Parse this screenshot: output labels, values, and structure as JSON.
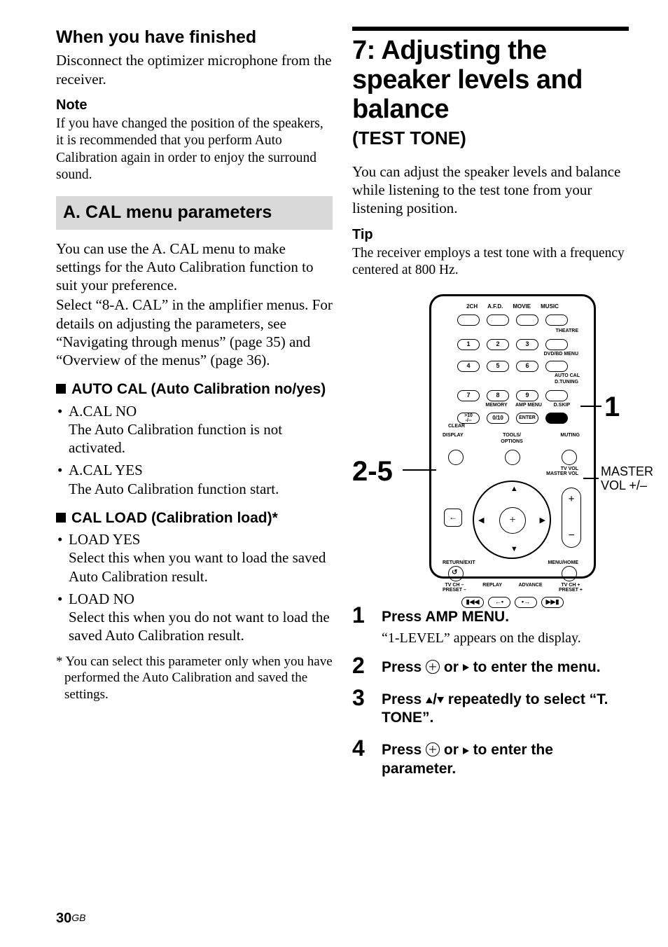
{
  "left": {
    "finished_heading": "When you have finished",
    "finished_text": "Disconnect the optimizer microphone from the receiver.",
    "note_heading": "Note",
    "note_text": "If you have changed the position of the speakers, it is recommended that you perform Auto Calibration again in order to enjoy the surround sound.",
    "band_heading": "A. CAL menu parameters",
    "band_intro1": "You can use the A. CAL menu to make settings for the Auto Calibration function to suit your preference.",
    "band_intro2": "Select “8-A. CAL” in the amplifier menus. For details on adjusting the parameters, see “Navigating through menus” (page 35) and “Overview of the menus” (page 36).",
    "block1_heading": "AUTO CAL (Auto Calibration no/yes)",
    "block1_items": [
      {
        "label": "A.CAL NO",
        "desc": "The Auto Calibration function is not activated."
      },
      {
        "label": "A.CAL YES",
        "desc": "The Auto Calibration function start."
      }
    ],
    "block2_heading": "CAL LOAD (Calibration load)*",
    "block2_items": [
      {
        "label": "LOAD YES",
        "desc": "Select this when you want to load the saved Auto Calibration result."
      },
      {
        "label": "LOAD NO",
        "desc": "Select this when you do not want to load the saved Auto Calibration result."
      }
    ],
    "footnote": "* You can select this parameter only when you have performed the Auto Calibration and saved the settings."
  },
  "right": {
    "title": "7: Adjusting the speaker levels and balance",
    "subtitle": "(TEST TONE)",
    "intro": "You can adjust the speaker levels and balance while listening to the test tone from your listening position.",
    "tip_heading": "Tip",
    "tip_text": "The receiver employs a test tone with a frequency centered at 800 Hz.",
    "remote": {
      "row0": [
        "2CH",
        "A.F.D.",
        "MOVIE",
        "MUSIC"
      ],
      "row_theatre": "THEATRE",
      "row1": [
        "1",
        "2",
        "3"
      ],
      "row_dvd": "DVD/BD MENU",
      "row2": [
        "4",
        "5",
        "6"
      ],
      "row_autocal": "AUTO CAL",
      "row_dtuning": "D.TUNING",
      "row3": [
        "7",
        "8",
        "9"
      ],
      "row_dskip": "D.SKIP",
      "row_mem": "MEMORY",
      "row_amp": "AMP MENU",
      "row4a": ">10",
      "row4b": "-/--",
      "row4_clear": "CLEAR",
      "row4c": "0/10",
      "row4d": "ENTER",
      "row_display": "DISPLAY",
      "row_tools": "TOOLS/\nOPTIONS",
      "row_muting": "MUTING",
      "row_tvvol": "TV VOL",
      "row_master": "MASTER VOL",
      "row_return": "RETURN/EXIT",
      "row_menuhome": "MENU/HOME",
      "row_tvchm": "TV CH –",
      "row_presetm": "PRESET –",
      "row_replay": "REPLAY",
      "row_advance": "ADVANCE",
      "row_tvchp": "TV CH +",
      "row_presetp": "PRESET +",
      "callout_25": "2-5",
      "callout_1": "1",
      "callout_master": "MASTER VOL +/–"
    },
    "steps": [
      {
        "num": "1",
        "title": "Press AMP MENU.",
        "desc": "“1-LEVEL” appears on the display."
      },
      {
        "num": "2",
        "title_pre": "Press ",
        "title_mid": " or ",
        "title_post": " to enter the menu.",
        "desc": ""
      },
      {
        "num": "3",
        "title_pre": "Press ",
        "title_mid": "/",
        "title_post": " repeatedly to select “T. TONE”.",
        "desc": ""
      },
      {
        "num": "4",
        "title_pre": "Press ",
        "title_mid": " or ",
        "title_post": " to enter the parameter.",
        "desc": ""
      }
    ]
  },
  "page": {
    "num": "30",
    "suffix": "GB"
  }
}
